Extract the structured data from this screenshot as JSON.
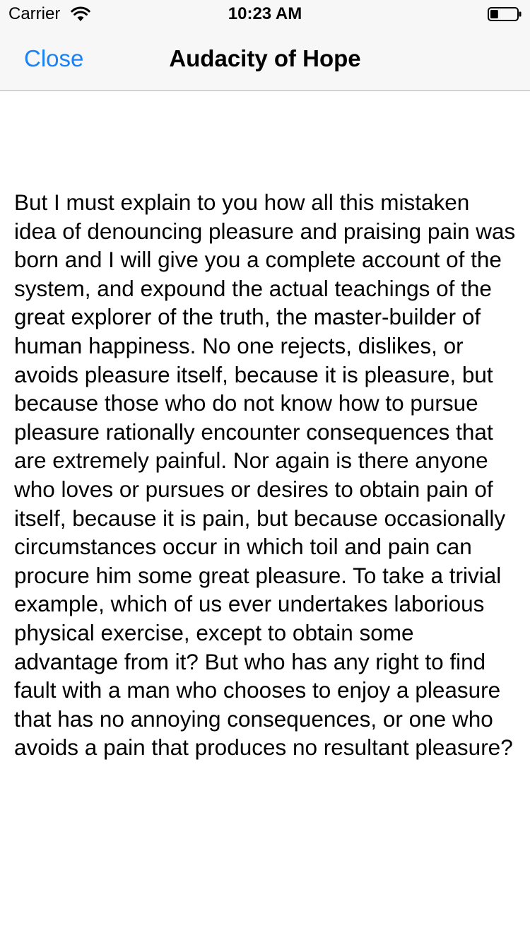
{
  "status_bar": {
    "carrier": "Carrier",
    "time": "10:23 AM",
    "wifi_icon": "wifi-icon",
    "battery_icon": "battery-icon",
    "battery_level": 0.3
  },
  "nav": {
    "close_label": "Close",
    "title": "Audacity of Hope",
    "accent_color": "#1a82f7"
  },
  "content": {
    "body": "But I must explain to you how all this mistaken idea of denouncing pleasure and praising pain was born and I will give you a complete account of the system, and expound the actual teachings of the great explorer of the truth, the master-builder of human happiness. No one rejects, dislikes, or avoids pleasure itself, because it is pleasure, but because those who do not know how to pursue pleasure rationally encounter consequences that are extremely painful. Nor again is there anyone who loves or pursues or desires to obtain pain of itself, because it is pain, but because occasionally circumstances occur in which toil and pain can procure him some great pleasure. To take a trivial example, which of us ever undertakes laborious physical exercise, except to obtain some advantage from it? But who has any right to find fault with a man who chooses to enjoy a pleasure that has no annoying consequences, or one who avoids a pain that produces no resultant pleasure?"
  }
}
